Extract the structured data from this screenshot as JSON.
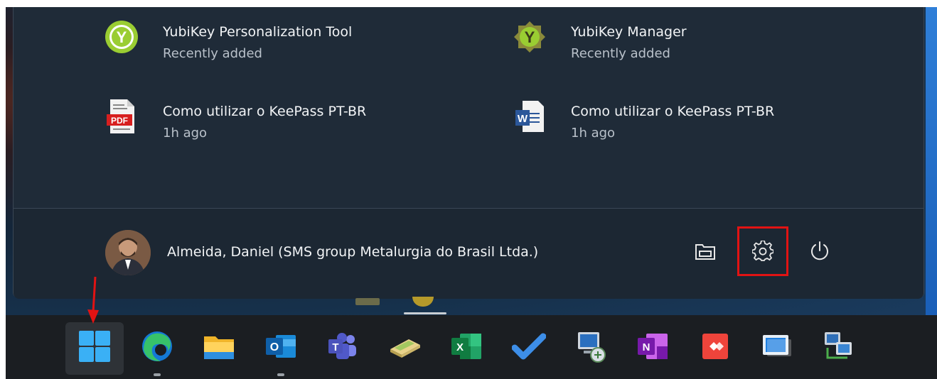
{
  "recommended": [
    {
      "title": "YubiKey Personalization Tool",
      "subtitle": "Recently added",
      "icon": "yubikey-personalization-icon"
    },
    {
      "title": "YubiKey Manager",
      "subtitle": "Recently added",
      "icon": "yubikey-manager-icon"
    },
    {
      "title": "Como utilizar o KeePass PT-BR",
      "subtitle": "1h ago",
      "icon": "pdf-file-icon"
    },
    {
      "title": "Como utilizar o KeePass PT-BR",
      "subtitle": "1h ago",
      "icon": "word-document-icon"
    }
  ],
  "footer": {
    "user_name": "Almeida, Daniel (SMS group Metalurgia do Brasil Ltda.)",
    "buttons": [
      "documents-folder-icon",
      "settings-gear-icon",
      "power-icon"
    ]
  },
  "icon_labels": {
    "pdf": "PDF",
    "word": "W",
    "outlook": "O",
    "teams": "T",
    "excel": "X",
    "onenote": "N",
    "yubikey": "Y"
  },
  "taskbar": {
    "items": [
      "start-windows-icon",
      "edge-icon",
      "file-explorer-icon",
      "outlook-icon",
      "teams-icon",
      "scanner-app-icon",
      "excel-icon",
      "todo-check-icon",
      "remote-computer-icon",
      "onenote-icon",
      "anydesk-icon",
      "remote-desktop-icon",
      "network-computers-icon"
    ]
  },
  "colors": {
    "annotation_red": "#e11313",
    "menu_bg": "#1f2b38",
    "taskbar_bg": "#1b1e22"
  }
}
